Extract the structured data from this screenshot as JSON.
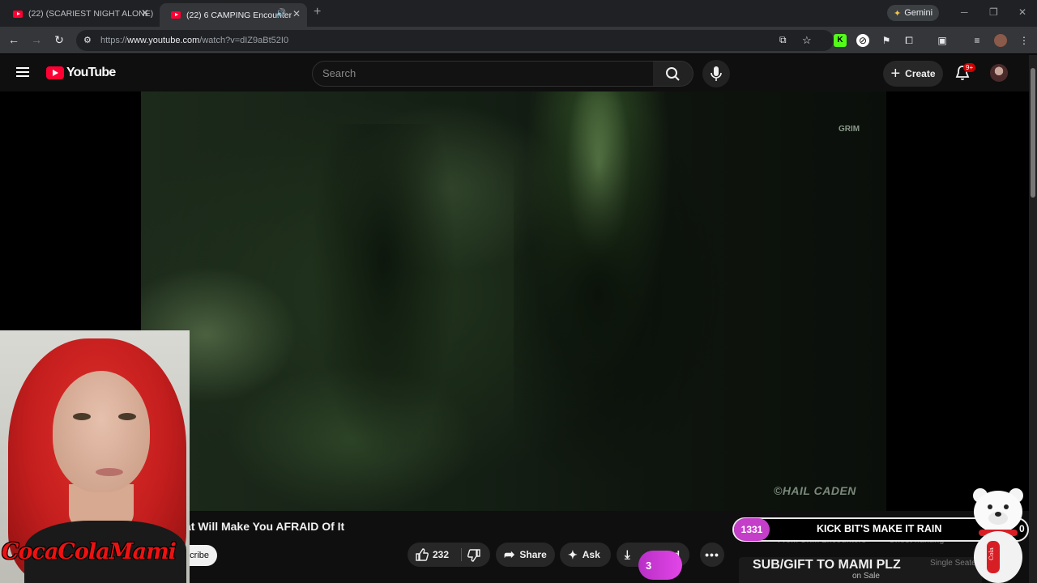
{
  "browser": {
    "tabs": [
      {
        "title": "(22) (SCARIEST NIGHT ALONE)",
        "active": false
      },
      {
        "title": "(22) 6 CAMPING Encounter",
        "active": true
      }
    ],
    "gemini_label": "Gemini",
    "url_prefix": "https://",
    "url_host": "www.youtube.com",
    "url_path": "/watch?v=dIZ9aBt52I0"
  },
  "masthead": {
    "logo_text": "YouTube",
    "search_placeholder": "Search",
    "create_label": "Create",
    "notification_badge": "9+"
  },
  "video": {
    "watermark_top": "GRIM",
    "watermark_bottom": "©HAIL CADEN",
    "title_visible": "at Will Make You AFRAID Of It",
    "subscribe_label": "cribe",
    "like_count": "232",
    "share_label": "Share",
    "ask_label": "Ask",
    "download_label": "d"
  },
  "stream_overlay": {
    "streamer_name": "CocaColaMami",
    "kick_count": "1331",
    "kick_text": "KICK BIT'S MAKE IT RAIN",
    "kick_right_digit": "0",
    "chip_1": "From Grim Encounters",
    "chip_2": "Ghost hunting",
    "sub_count": "3",
    "sub_text": "SUB/GIFT TO MAMI PLZ",
    "single_seater": "Single Seater F",
    "on_sale": "on Sale"
  },
  "colors": {
    "youtube_red": "#ff0033",
    "overlay_purple": "#c43ec9",
    "background": "#0f0f0f"
  }
}
